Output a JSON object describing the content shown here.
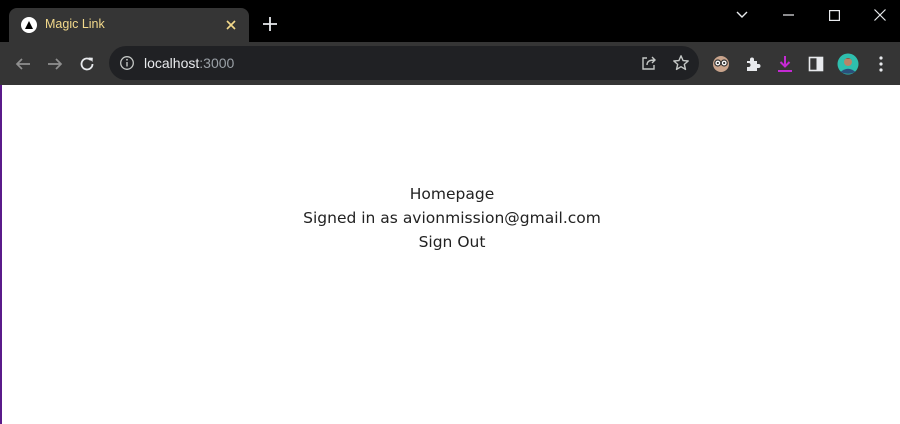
{
  "browser": {
    "tab": {
      "title": "Magic Link"
    },
    "address_bar": {
      "host": "localhost",
      "port": ":3000"
    }
  },
  "page": {
    "heading": "Homepage",
    "signed_in_prefix": "Signed in as ",
    "email": "avionmission@gmail.com",
    "sign_out_label": "Sign Out"
  },
  "colors": {
    "frame": "#000000",
    "toolbar": "#353535",
    "omnibox": "#202124",
    "tab_title": "#f3d98b",
    "download_accent": "#c42ad3",
    "page_background": "#ffffff"
  }
}
